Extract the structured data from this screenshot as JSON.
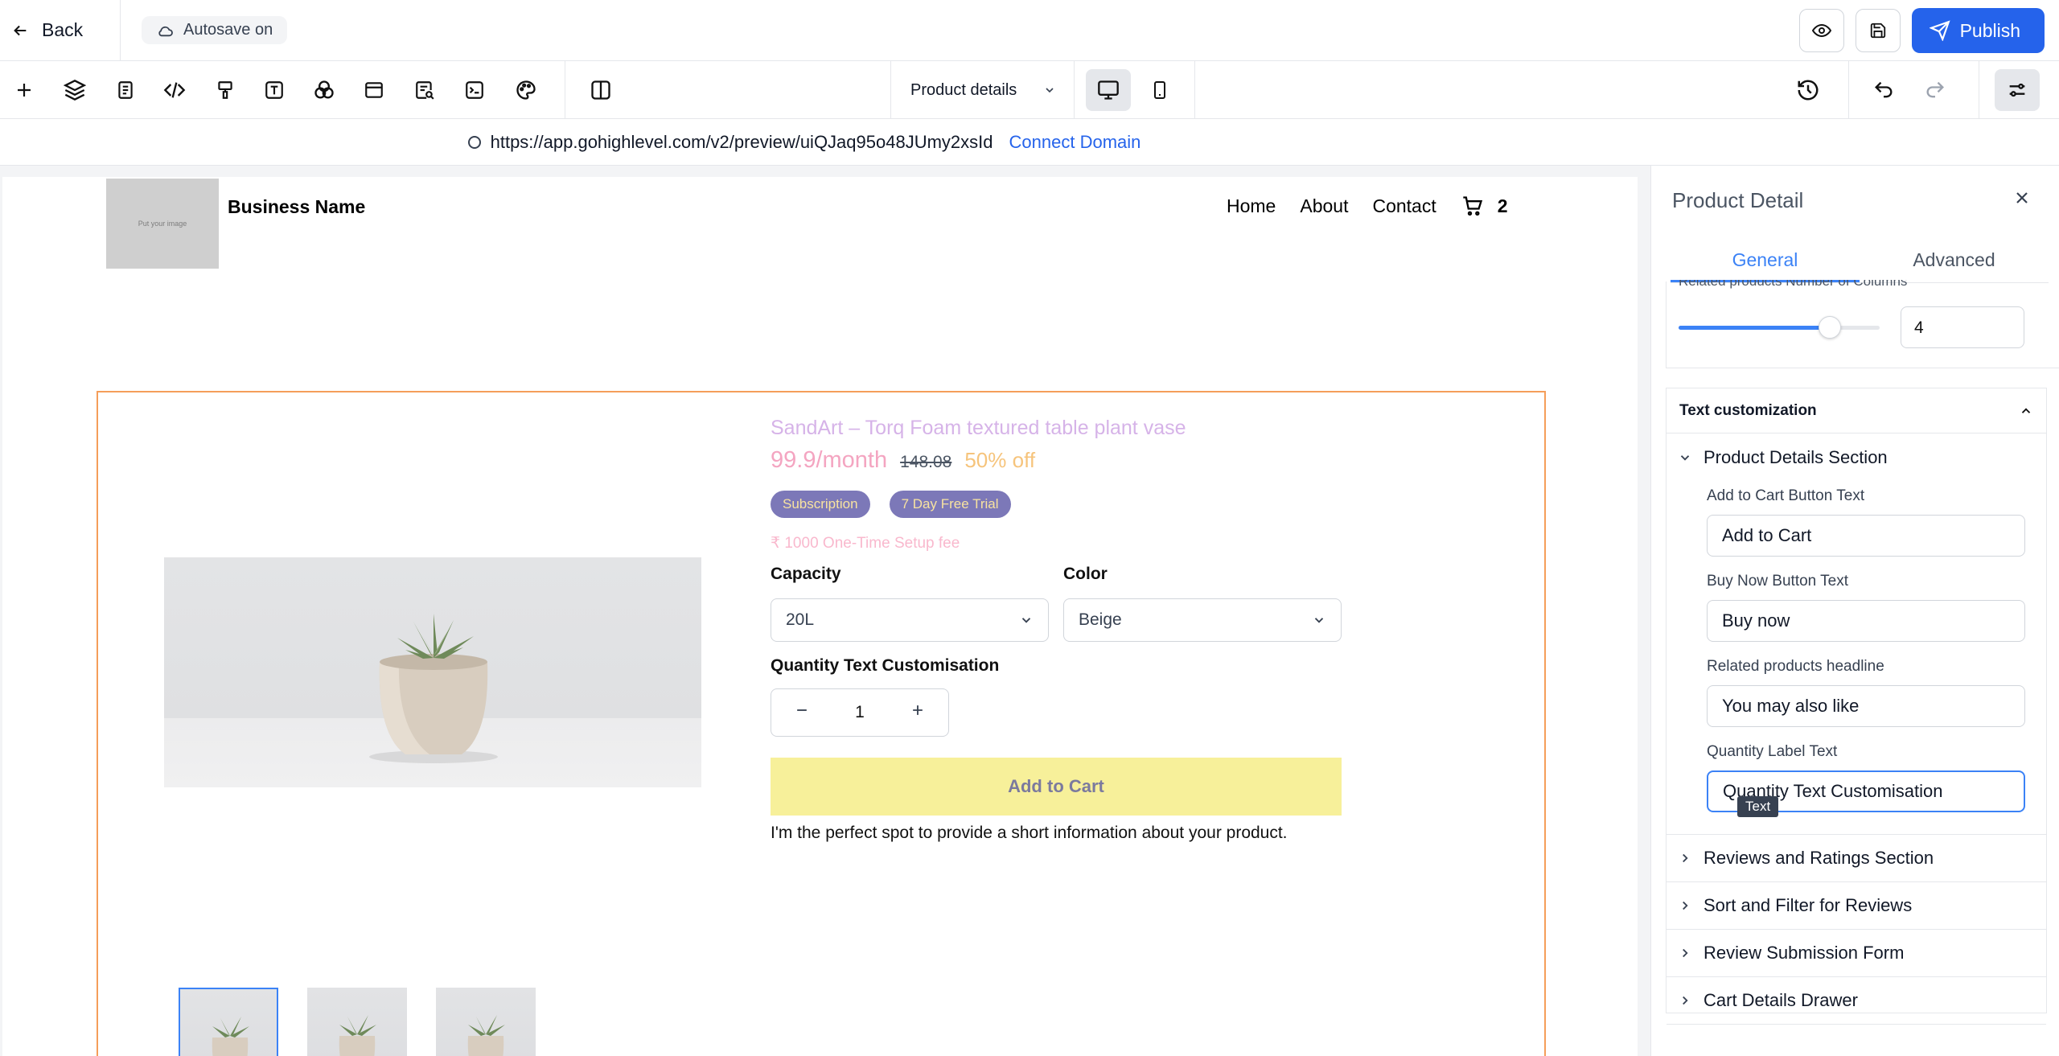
{
  "topbar": {
    "back_label": "Back",
    "autosave_label": "Autosave on",
    "publish_label": "Publish"
  },
  "toolbar": {
    "tools": [
      "add-icon",
      "layers-icon",
      "page-icon",
      "code-icon",
      "paint-icon",
      "text-icon",
      "shapes-icon",
      "layout-icon",
      "form-icon",
      "terminal-icon",
      "palette-icon",
      "columns-icon"
    ],
    "page_select": "Product details",
    "devices": [
      "desktop",
      "mobile"
    ]
  },
  "urlbar": {
    "url": "https://app.gohighlevel.com/v2/preview/uiQJaq95o48JUmy2xsId",
    "connect_label": "Connect Domain"
  },
  "site": {
    "logo_text": "Put your image",
    "business_name": "Business Name",
    "nav": [
      "Home",
      "About",
      "Contact"
    ],
    "cart_count": "2"
  },
  "product": {
    "title": "SandArt – Torq Foam textured table plant vase",
    "price": "99.9/month",
    "compare_price": "148.08",
    "discount": "50% off",
    "badges": [
      "Subscription",
      "7 Day Free Trial"
    ],
    "setup_fee": "₹ 1000 One-Time Setup fee",
    "capacity_label": "Capacity",
    "capacity_value": "20L",
    "color_label": "Color",
    "color_value": "Beige",
    "quantity_label": "Quantity Text Customisation",
    "quantity_value": "1",
    "add_to_cart": "Add to Cart",
    "description": "I'm the perfect spot to provide a short information about your product."
  },
  "panel": {
    "title": "Product Detail",
    "tabs": [
      "General",
      "Advanced"
    ],
    "related_columns_label": "Related products Number of Columns",
    "related_columns_value": "4",
    "related_columns_fraction": 0.75,
    "section_title": "Text customization",
    "open_group": "Product Details Section",
    "fields": [
      {
        "label": "Add to Cart Button Text",
        "value": "Add to Cart"
      },
      {
        "label": "Buy Now Button Text",
        "value": "Buy now"
      },
      {
        "label": "Related products headline",
        "value": "You may also like"
      },
      {
        "label": "Quantity Label Text",
        "value": "Quantity Text Customisation"
      }
    ],
    "tooltip": "Text",
    "groups": [
      "Reviews and Ratings Section",
      "Sort and Filter for Reviews",
      "Review Submission Form",
      "Cart Details Drawer"
    ]
  },
  "colors": {
    "accent": "#2563eb",
    "selection_border": "#f59e5a",
    "add_to_cart_bg": "#f7f09a",
    "badge_bg": "#7c78b8"
  }
}
